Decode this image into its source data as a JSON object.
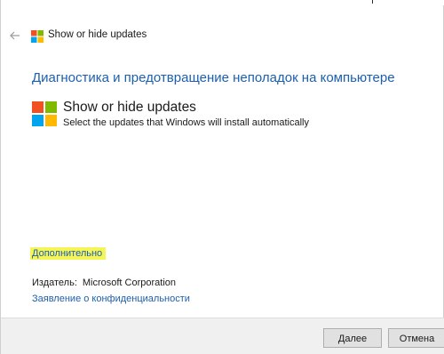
{
  "window": {
    "title": "Show or hide updates"
  },
  "icons": {
    "back": "back-arrow-icon",
    "logo": "windows-logo-icon"
  },
  "colors": {
    "accent_text": "#1c5fb0",
    "highlight": "#f5f55a",
    "logo_red": "#f25022",
    "logo_green": "#7fba00",
    "logo_blue": "#00a4ef",
    "logo_yellow": "#ffb900"
  },
  "main": {
    "heading": "Диагностика и предотвращение неполадок на компьютере",
    "item": {
      "title": "Show or hide updates",
      "description": "Select the updates that Windows will install automatically"
    },
    "advanced_link": "Дополнительно",
    "publisher_label": "Издатель:",
    "publisher_value": "Microsoft Corporation",
    "privacy_link": "Заявление о конфиденциальности"
  },
  "footer": {
    "next_label": "Далее",
    "cancel_label": "Отмена"
  }
}
